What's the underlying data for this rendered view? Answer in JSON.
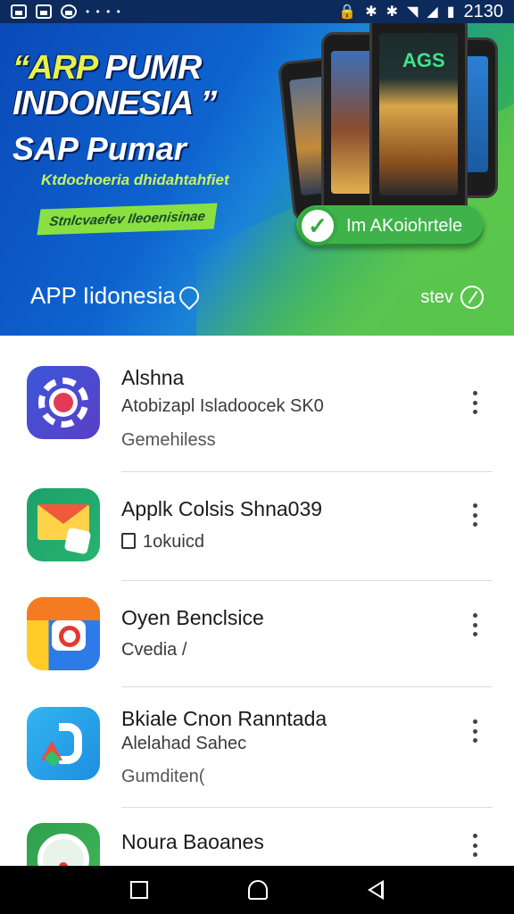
{
  "status_bar": {
    "time": "2130",
    "left_icons": [
      "gallery-icon",
      "image-icon",
      "chat-icon"
    ],
    "right_icons": [
      "lock-icon",
      "bluetooth-icon",
      "bluetooth-icon",
      "wifi-icon",
      "signal-icon",
      "battery-icon"
    ]
  },
  "banner": {
    "headline_quote_open": "“",
    "headline_line1_a": "ARP",
    "headline_line1_b": " PUMR",
    "headline_line2": "INDONESIA ”",
    "headline_line3": "SAP Pumar",
    "subtitle": "Ktdochoeria dhidahtahfiet",
    "tagline": "Stnlcvaefev Ileoenisinae",
    "phone_screen_text": "AGS",
    "cta_label": "Im AKoiohrtele",
    "footer_label": "APP Iidonesia",
    "footer_right": "stev"
  },
  "apps": [
    {
      "title": "Alshna",
      "line2": "Atobizapl Isladoocek SK0",
      "line3": "Gemehiless"
    },
    {
      "title": "Applk Colsis Shna039",
      "line2": "1okuicd",
      "line3": ""
    },
    {
      "title": "Oyen Benclsice",
      "line2": "Cvedia /",
      "line3": ""
    },
    {
      "title": "Bkiale Cnon Ranntada",
      "line2": "Alelahad Sahec",
      "line3": "Gumditen("
    },
    {
      "title": "Noura Baoanes",
      "line2": "",
      "line3": ""
    }
  ],
  "colors": {
    "banner_blue": "#0e63cf",
    "banner_green": "#4cc04c",
    "headline_yellow": "#e7f24a",
    "cta_green": "#3fb34a"
  }
}
